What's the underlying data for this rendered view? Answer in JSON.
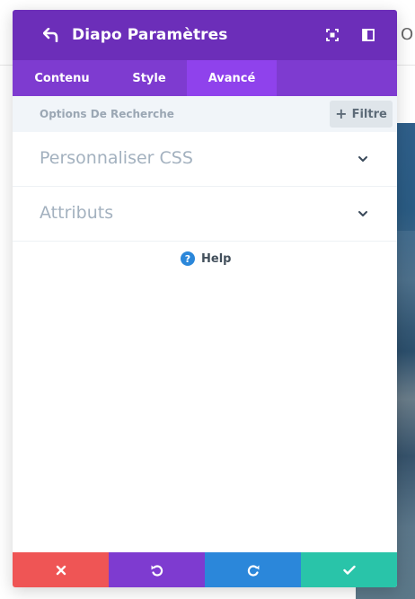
{
  "page": {
    "background_glyph": "O"
  },
  "modal": {
    "title": "Diapo Paramètres",
    "header_icons": [
      "back-arrow-icon",
      "expand-icon",
      "layout-split-icon"
    ],
    "tabs": [
      {
        "label": "Contenu",
        "active": false
      },
      {
        "label": "Style",
        "active": false
      },
      {
        "label": "Avancé",
        "active": true
      }
    ],
    "search": {
      "placeholder": "Options De Recherche",
      "filter_label": "Filtre"
    },
    "sections": [
      {
        "label": "Personnaliser CSS",
        "icon": "chevron-down-icon"
      },
      {
        "label": "Attributs",
        "icon": "chevron-down-icon"
      }
    ],
    "help": {
      "label": "Help",
      "icon": "question-circle-icon"
    },
    "footer_buttons": [
      {
        "name": "cancel",
        "icon": "close-icon",
        "color": "#ef5555"
      },
      {
        "name": "undo",
        "icon": "undo-icon",
        "color": "#7e3bd0"
      },
      {
        "name": "redo",
        "icon": "redo-icon",
        "color": "#2b87da"
      },
      {
        "name": "save",
        "icon": "check-icon",
        "color": "#29c4a9"
      }
    ],
    "colors": {
      "header": "#6c2eb9",
      "tabs": "#7e3bd0",
      "active_tab": "#8f42ec"
    }
  }
}
